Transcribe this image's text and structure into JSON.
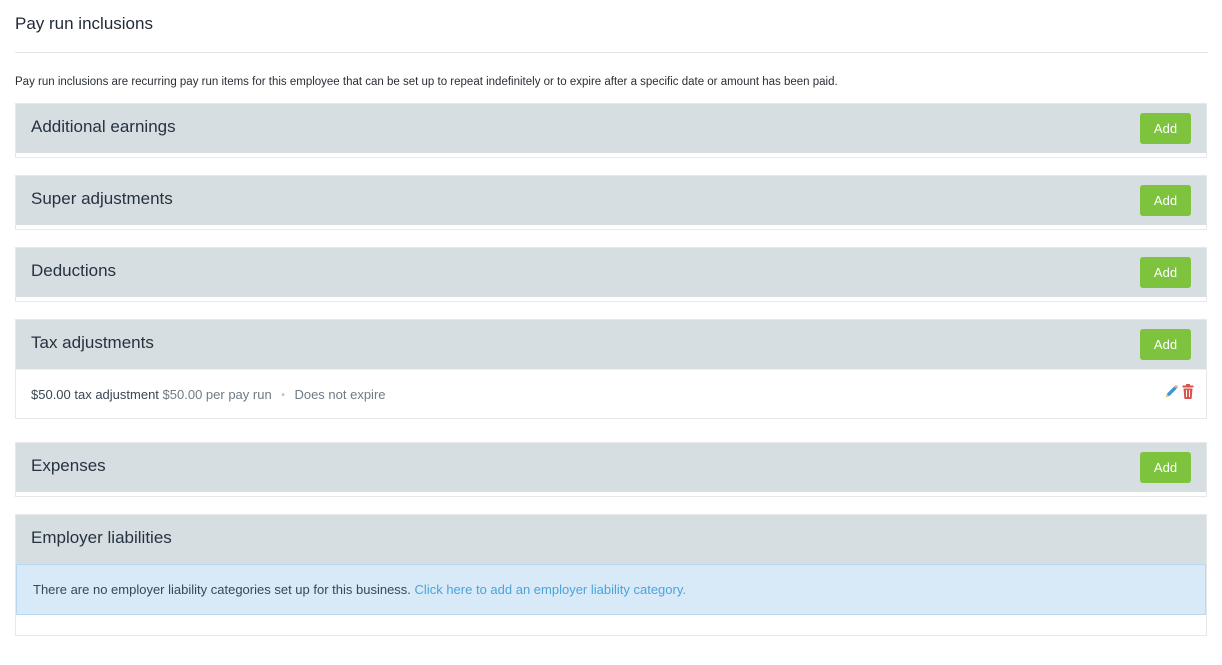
{
  "page": {
    "title": "Pay run inclusions",
    "intro": "Pay run inclusions are recurring pay run items for this employee that can be set up to repeat indefinitely or to expire after a specific date or amount has been paid."
  },
  "sections": {
    "additional_earnings": {
      "title": "Additional earnings",
      "add_label": "Add"
    },
    "super_adjustments": {
      "title": "Super adjustments",
      "add_label": "Add"
    },
    "deductions": {
      "title": "Deductions",
      "add_label": "Add"
    },
    "tax_adjustments": {
      "title": "Tax adjustments",
      "add_label": "Add",
      "items": [
        {
          "amount_label": "$50.00 tax adjustment",
          "frequency": "$50.00 per pay run",
          "separator": "•",
          "expiry": "Does not expire"
        }
      ]
    },
    "expenses": {
      "title": "Expenses",
      "add_label": "Add"
    },
    "employer_liabilities": {
      "title": "Employer liabilities",
      "notice": "There are no employer liability categories set up for this business.",
      "notice_link": "Click here to add an employer liability category."
    }
  },
  "colors": {
    "accent_green": "#7dc33d",
    "header_gray": "#d7dee2",
    "info_blue": "#d8eaf7",
    "link_blue": "#4ba3db",
    "delete_red": "#d9534f",
    "edit_blue": "#3a95d6"
  },
  "icons": {
    "edit": "pencil-icon",
    "delete": "trash-icon"
  }
}
